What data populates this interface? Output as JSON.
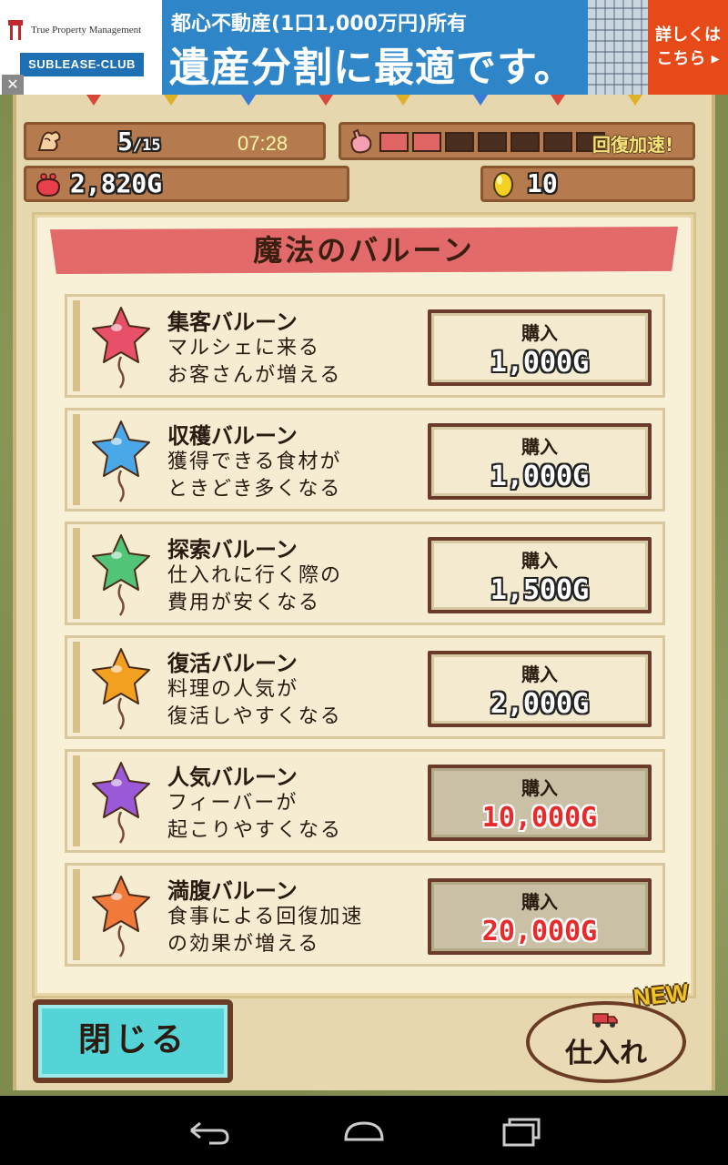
{
  "ad": {
    "brand": "True Property Management",
    "club": "SUBLEASE-CLUB",
    "line1": "都心不動産(1口1,000万円)所有",
    "line2": "遺産分割に最適です。",
    "cta_line1": "詳しくは",
    "cta_line2": "こちら ▸",
    "close": "✕"
  },
  "status": {
    "stamina": "5",
    "stamina_max": "/15",
    "time": "07:28",
    "meter_filled": 2,
    "meter_total": 7,
    "boost": "回復加速!",
    "gold": "2,820G",
    "eggs": "10"
  },
  "panel": {
    "title": "魔法のバルーン",
    "items": [
      {
        "name": "集客バルーン",
        "desc1": "マルシェに来る",
        "desc2": "お客さんが増える",
        "buy": "購入",
        "price": "1,000G",
        "affordable": true,
        "color": "#e8506a"
      },
      {
        "name": "収穫バルーン",
        "desc1": "獲得できる食材が",
        "desc2": "ときどき多くなる",
        "buy": "購入",
        "price": "1,000G",
        "affordable": true,
        "color": "#4aa8e8"
      },
      {
        "name": "探索バルーン",
        "desc1": "仕入れに行く際の",
        "desc2": "費用が安くなる",
        "buy": "購入",
        "price": "1,500G",
        "affordable": true,
        "color": "#52c478"
      },
      {
        "name": "復活バルーン",
        "desc1": "料理の人気が",
        "desc2": "復活しやすくなる",
        "buy": "購入",
        "price": "2,000G",
        "affordable": true,
        "color": "#f2a020"
      },
      {
        "name": "人気バルーン",
        "desc1": "フィーバーが",
        "desc2": "起こりやすくなる",
        "buy": "購入",
        "price": "10,000G",
        "affordable": false,
        "color": "#9a5ad8"
      },
      {
        "name": "満腹バルーン",
        "desc1": "食事による回復加速",
        "desc2": "の効果が増える",
        "buy": "購入",
        "price": "20,000G",
        "affordable": false,
        "color": "#f07a3a"
      }
    ]
  },
  "buttons": {
    "close": "閉じる",
    "shop": "仕入れ",
    "new_badge": "NEW"
  }
}
